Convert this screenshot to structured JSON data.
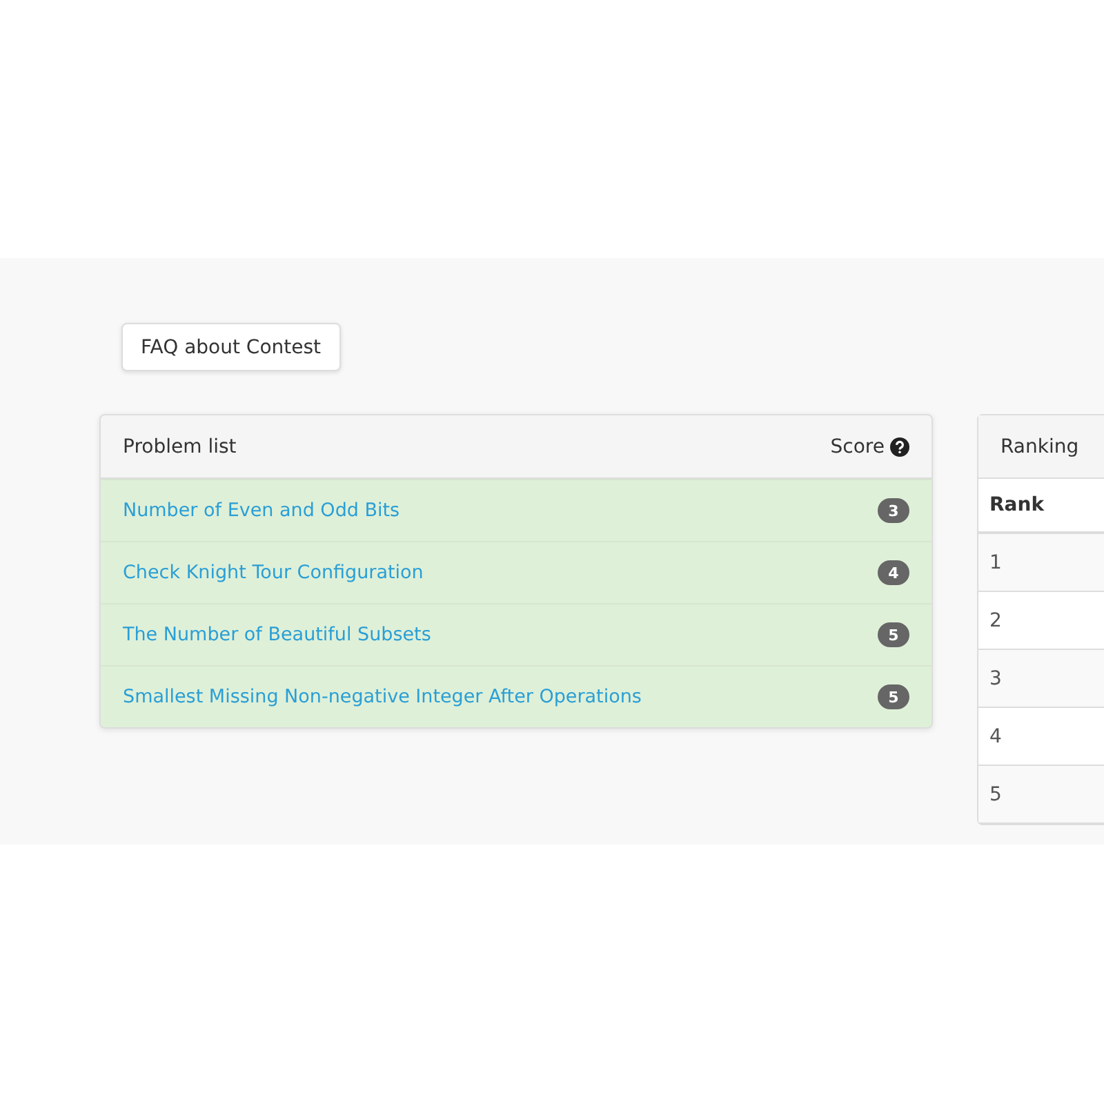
{
  "faq_button": "FAQ about Contest",
  "problem_list": {
    "title": "Problem list",
    "score_label": "Score",
    "problems": [
      {
        "name": "Number of Even and Odd Bits",
        "score": "3"
      },
      {
        "name": "Check Knight Tour Configuration",
        "score": "4"
      },
      {
        "name": "The Number of Beautiful Subsets",
        "score": "5"
      },
      {
        "name": "Smallest Missing Non-negative Integer After Operations",
        "score": "5"
      }
    ]
  },
  "ranking": {
    "title": "Ranking",
    "column": "Rank",
    "rows": [
      "1",
      "2",
      "3",
      "4",
      "5"
    ]
  }
}
